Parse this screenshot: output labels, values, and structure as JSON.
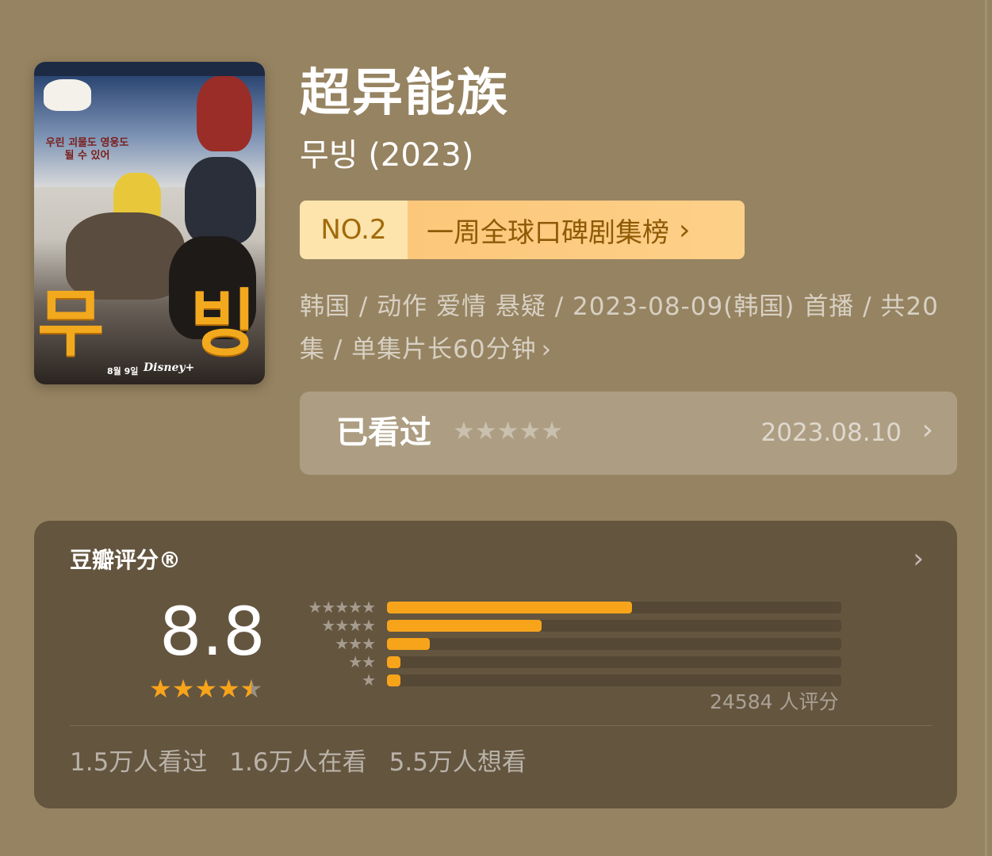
{
  "header": {
    "title": "超异能族",
    "subtitle": "무빙 (2023)"
  },
  "poster": {
    "tagline": "우린 괴물도 영웅도 될 수 있어",
    "title_left": "무",
    "title_right": "빙",
    "date": "8월 9일",
    "brand": "Disney+"
  },
  "rank": {
    "number": "NO.2",
    "label": "一周全球口碑剧集榜",
    "chevron": "›"
  },
  "meta": {
    "line": "韩国 / 动作 爱情 悬疑 / 2023-08-09(韩国) 首播 / 共20集 / 单集片长60分钟",
    "chevron": "›"
  },
  "watched": {
    "label": "已看过",
    "stars": "★★★★★",
    "date": "2023.08.10",
    "chevron": "›"
  },
  "rating": {
    "title": "豆瓣评分®",
    "chevron": "›",
    "score": "8.8",
    "stars_full": 4,
    "stars_half": 1,
    "star_glyph": "★",
    "count_text": "24584 人评分",
    "distribution": [
      {
        "stars": "★★★★★",
        "fraction": 0.54
      },
      {
        "stars": "★★★★",
        "fraction": 0.34
      },
      {
        "stars": "★★★",
        "fraction": 0.095
      },
      {
        "stars": "★★",
        "fraction": 0.03
      },
      {
        "stars": "★",
        "fraction": 0.03
      }
    ],
    "stats": {
      "watched": "1.5万人看过",
      "watching": "1.6万人在看",
      "want": "5.5万人想看"
    }
  },
  "colors": {
    "background": "#968361",
    "card": "#64553f",
    "accent_orange": "#f7a41b",
    "badge_left": "#fce4ac",
    "badge_right": "#fcc77a"
  }
}
